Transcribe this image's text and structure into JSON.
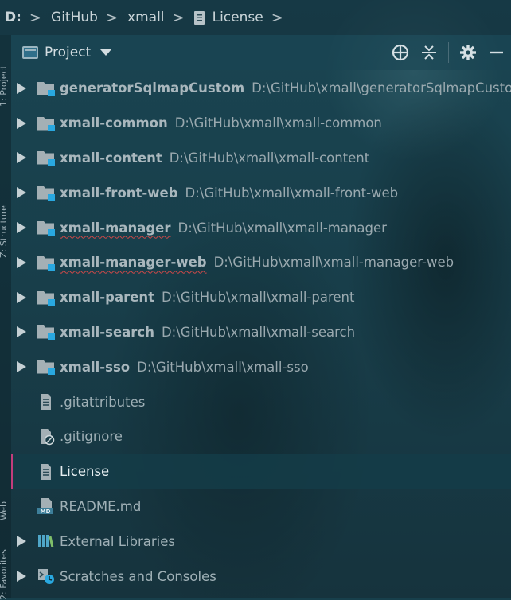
{
  "breadcrumb": {
    "items": [
      "D:",
      "GitHub",
      "xmall",
      "License"
    ]
  },
  "left_strip": {
    "labels": [
      "1: Project",
      "Z: Structure",
      "Web",
      "2: Favorites"
    ]
  },
  "project_header": {
    "title": "Project",
    "icons": [
      "locate-icon",
      "collapse-all-icon",
      "gear-icon",
      "minimize-icon"
    ]
  },
  "tree": {
    "modules": [
      {
        "name": "generatorSqlmapCustom",
        "path": "D:\\GitHub\\xmall\\generatorSqlmapCustom",
        "spell_error": false
      },
      {
        "name": "xmall-common",
        "path": "D:\\GitHub\\xmall\\xmall-common",
        "spell_error": false
      },
      {
        "name": "xmall-content",
        "path": "D:\\GitHub\\xmall\\xmall-content",
        "spell_error": false
      },
      {
        "name": "xmall-front-web",
        "path": "D:\\GitHub\\xmall\\xmall-front-web",
        "spell_error": false
      },
      {
        "name": "xmall-manager",
        "path": "D:\\GitHub\\xmall\\xmall-manager",
        "spell_error": true
      },
      {
        "name": "xmall-manager-web",
        "path": "D:\\GitHub\\xmall\\xmall-manager-web",
        "spell_error": true
      },
      {
        "name": "xmall-parent",
        "path": "D:\\GitHub\\xmall\\xmall-parent",
        "spell_error": false
      },
      {
        "name": "xmall-search",
        "path": "D:\\GitHub\\xmall\\xmall-search",
        "spell_error": false
      },
      {
        "name": "xmall-sso",
        "path": "D:\\GitHub\\xmall\\xmall-sso",
        "spell_error": false
      }
    ],
    "files": [
      {
        "name": ".gitattributes",
        "icon": "text-file-icon",
        "selected": false
      },
      {
        "name": ".gitignore",
        "icon": "gitignore-file-icon",
        "selected": false
      },
      {
        "name": "License",
        "icon": "text-file-icon",
        "selected": true
      },
      {
        "name": "README.md",
        "icon": "markdown-file-icon",
        "selected": false
      }
    ],
    "external_libraries": "External Libraries",
    "scratches": "Scratches and Consoles"
  },
  "colors": {
    "selection_marker": "#c23d7c",
    "module_badge": "#29a8e0",
    "spell_error": "#d04848"
  }
}
